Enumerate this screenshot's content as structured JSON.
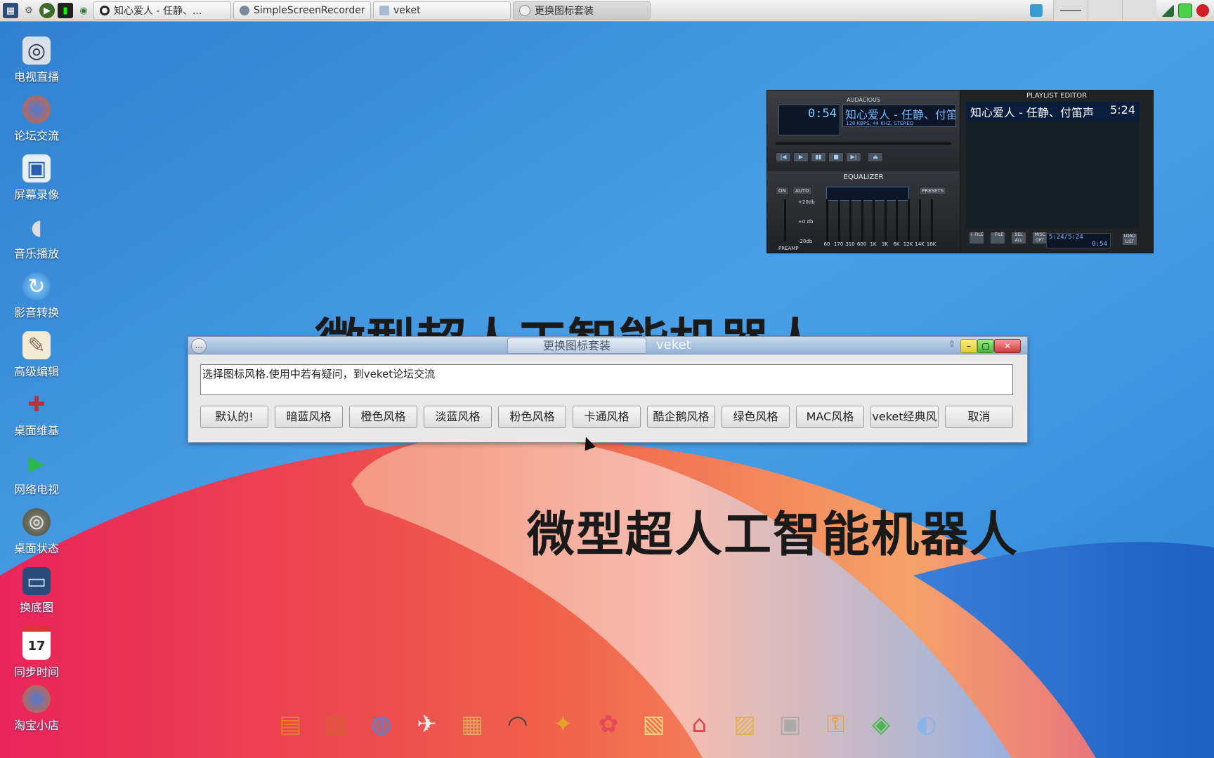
{
  "taskbar": {
    "launchers": [
      {
        "icon": "system-monitor-icon"
      },
      {
        "icon": "settings-gear-icon"
      },
      {
        "icon": "play-icon"
      },
      {
        "icon": "terminal-icon"
      },
      {
        "icon": "globe-icon"
      }
    ],
    "tasks": [
      {
        "label": "知心爱人 - 任静、...",
        "icon": "record-icon",
        "active": false
      },
      {
        "label": "SimpleScreenRecorder",
        "icon": "screen-recorder-icon",
        "active": false
      },
      {
        "label": "veket",
        "icon": "folder-icon",
        "active": false
      },
      {
        "label": "更换图标套装",
        "icon": "chat-bubble-icon",
        "active": true
      }
    ],
    "tray": [
      "monitor-icon",
      "network-icon",
      "battery-icon",
      "power-icon"
    ]
  },
  "desktop_icons": [
    {
      "label": "电视直播",
      "icon": "tv-icon"
    },
    {
      "label": "论坛交流",
      "icon": "firefox-icon"
    },
    {
      "label": "屏幕录像",
      "icon": "camera-icon"
    },
    {
      "label": "音乐播放",
      "icon": "speaker-icon"
    },
    {
      "label": "影音转换",
      "icon": "media-convert-icon"
    },
    {
      "label": "高级编辑",
      "icon": "notepad-icon"
    },
    {
      "label": "桌面维基",
      "icon": "wiki-icon"
    },
    {
      "label": "网络电视",
      "icon": "play-triangle-icon"
    },
    {
      "label": "桌面状态",
      "icon": "status-icon"
    },
    {
      "label": "换底图",
      "icon": "wallpaper-icon"
    },
    {
      "label": "同步时间",
      "icon": "calendar-icon"
    },
    {
      "label": "淘宝小店",
      "icon": "firefox-icon"
    }
  ],
  "wallpaper": {
    "partial_text": "微型超人工智能机器人",
    "headline": "微型超人工智能机器人"
  },
  "audacious": {
    "title": "AUDACIOUS",
    "time": "0:54",
    "song": "知心爱人 - 任静、付笛声",
    "bitrate": "128 KBPS, 44 KHZ, STEREO",
    "equalizer_title": "EQUALIZER",
    "eq_on": "ON",
    "eq_auto": "AUTO",
    "eq_presets": "PRESETS",
    "eq_preamp": "PREAMP",
    "eq_db_top": "+20db",
    "eq_db_mid": "+0 db",
    "eq_db_bot": "-20db",
    "eq_freqs": [
      "60",
      "170",
      "310",
      "600",
      "1K",
      "3K",
      "6K",
      "12K",
      "14K",
      "16K"
    ],
    "playlist_title": "PLAYLIST EDITOR",
    "playlist": [
      {
        "title": "知心爱人 - 任静、付笛声",
        "duration": "5:24"
      }
    ],
    "playlist_time": "5:24/5:24",
    "playlist_elapsed": "0:54",
    "btn_add": "+ FILE",
    "btn_rem": "- FILE",
    "btn_sel": "SEL ALL",
    "btn_misc": "MISC OPT",
    "btn_list": "LOAD LIST"
  },
  "dialog": {
    "title": "更换图标套装",
    "subtitle": "veket",
    "message": "选择图标风格.使用中若有疑问，到veket论坛交流",
    "buttons": [
      "默认的!",
      "暗蓝风格",
      "橙色风格",
      "淡蓝风格",
      "粉色风格",
      "卡通风格",
      "酷企鹅风格",
      "绿色风格",
      "MAC风格",
      "veket经典风",
      "取消"
    ]
  },
  "dock_icons": [
    "printer-icon",
    "desk-icon",
    "globe-icon",
    "airplane-icon",
    "drawer-icon",
    "headset-icon",
    "satellite-icon",
    "gift-icon",
    "documents-icon",
    "house-icon",
    "map-icon",
    "computer-icon",
    "lock-icon",
    "network-icon",
    "mouse-icon"
  ]
}
